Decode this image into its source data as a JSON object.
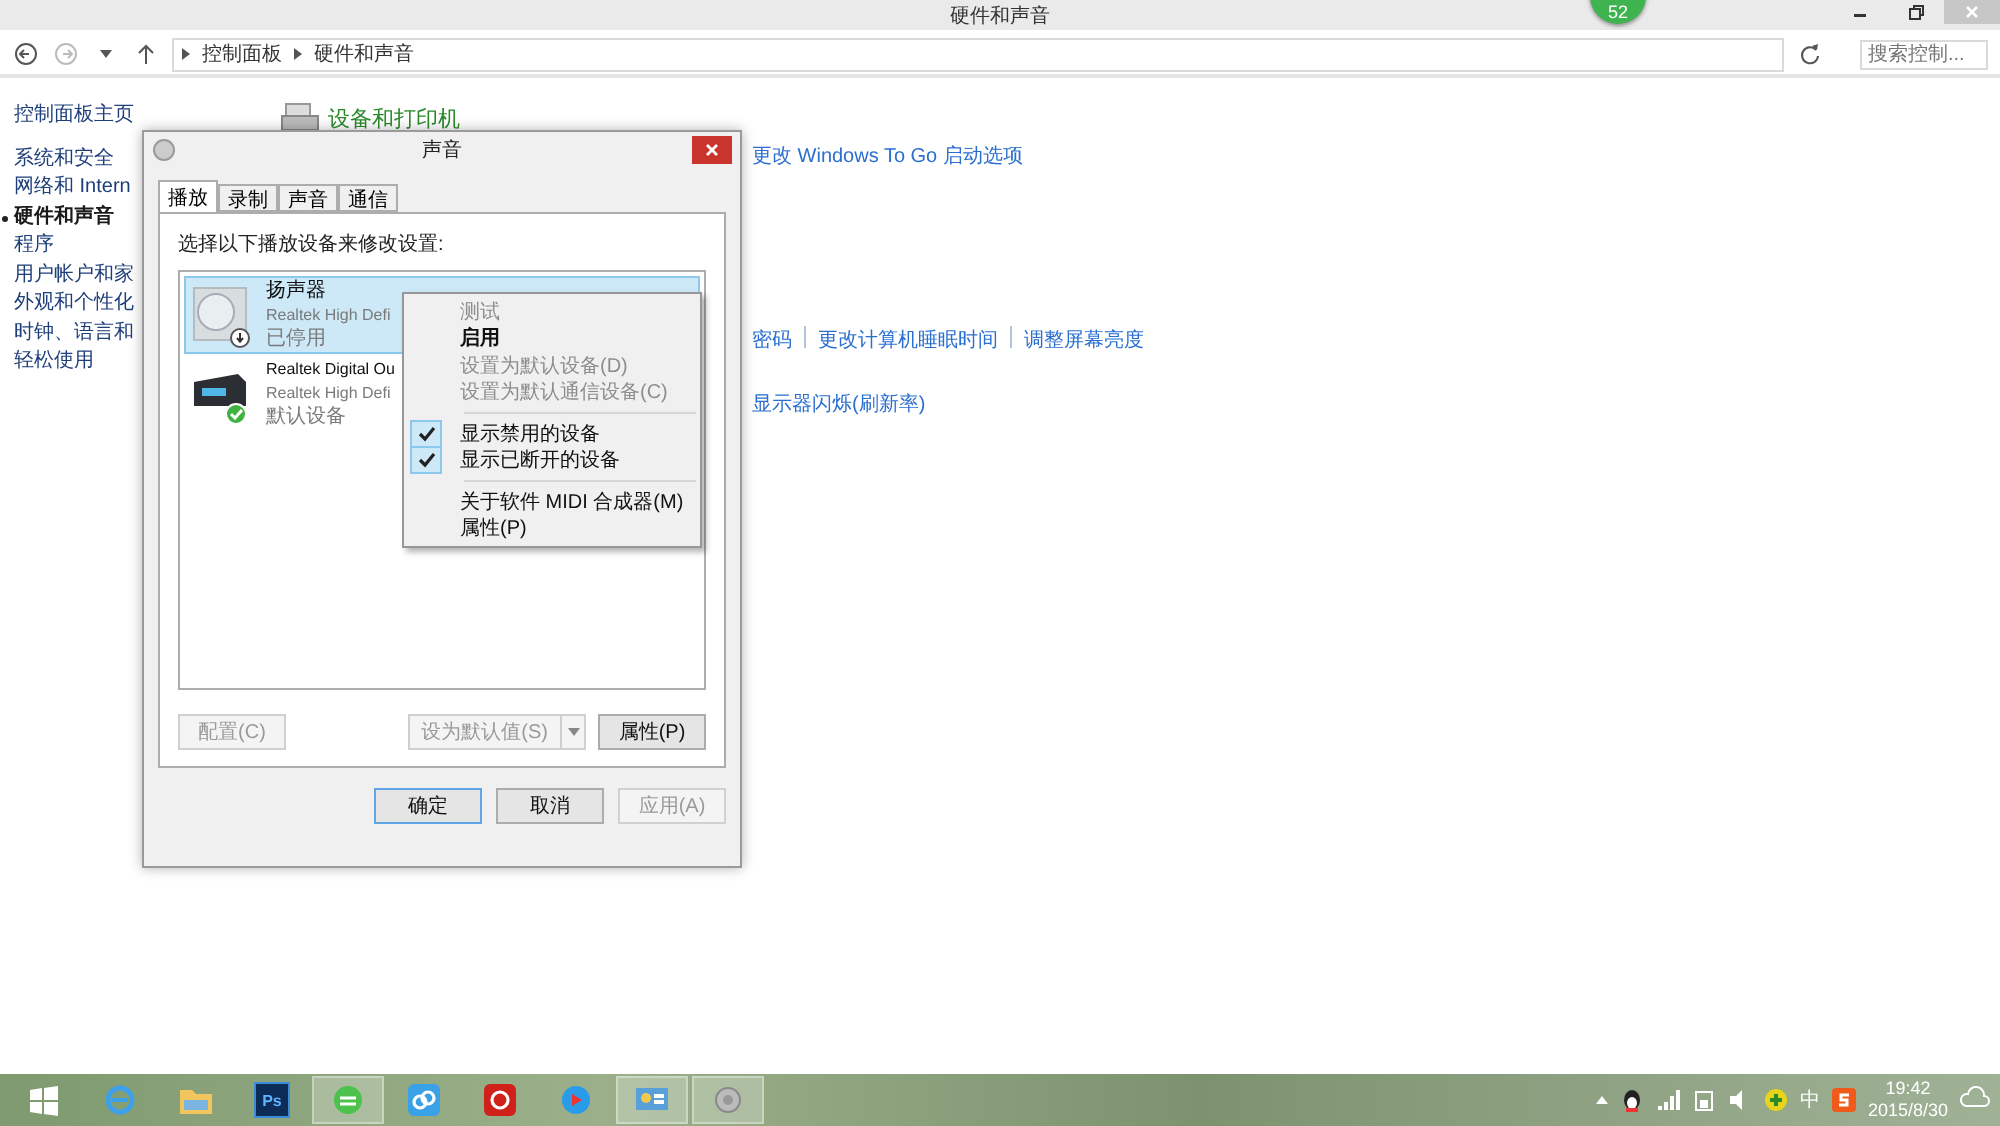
{
  "window": {
    "title": "硬件和声音"
  },
  "address_bar": {
    "crumbs": [
      "控制面板",
      "硬件和声音"
    ]
  },
  "search": {
    "placeholder": "搜索控制..."
  },
  "floating_badge": "52",
  "sidebar": {
    "items": [
      {
        "label": "控制面板主页",
        "selected": false
      },
      {
        "label": "系统和安全",
        "selected": false
      },
      {
        "label": "网络和 Intern",
        "selected": false
      },
      {
        "label": "硬件和声音",
        "selected": true
      },
      {
        "label": "程序",
        "selected": false
      },
      {
        "label": "用户帐户和家",
        "selected": false
      },
      {
        "label": "外观和个性化",
        "selected": false
      },
      {
        "label": "时钟、语言和",
        "selected": false
      },
      {
        "label": "轻松使用",
        "selected": false
      }
    ]
  },
  "content": {
    "heading": "设备和打印机",
    "link_rows": [
      [
        "更改 Windows To Go 启动选项"
      ],
      [
        "密码",
        "更改计算机睡眠时间",
        "调整屏幕亮度"
      ],
      [
        "显示器闪烁(刷新率)"
      ]
    ]
  },
  "dialog": {
    "title": "声音",
    "tabs": [
      {
        "label": "播放",
        "selected": true
      },
      {
        "label": "录制",
        "selected": false
      },
      {
        "label": "声音",
        "selected": false
      },
      {
        "label": "通信",
        "selected": false
      }
    ],
    "instruction": "选择以下播放设备来修改设置:",
    "devices": [
      {
        "name": "扬声器",
        "driver": "Realtek High Defi",
        "status": "已停用",
        "kind": "speaker",
        "selected": true
      },
      {
        "name": "Realtek Digital Ou",
        "driver": "Realtek High Defi",
        "status": "默认设备",
        "kind": "digital",
        "selected": false
      }
    ],
    "buttons": [
      {
        "label": "配置(C)",
        "disabled": true
      },
      {
        "label": "设为默认值(S)",
        "disabled": true
      },
      {
        "label": "属性(P)",
        "disabled": false
      }
    ],
    "footer_buttons": [
      {
        "label": "确定",
        "disabled": false,
        "selected": true
      },
      {
        "label": "取消",
        "disabled": false,
        "selected": false
      },
      {
        "label": "应用(A)",
        "disabled": true,
        "selected": false
      }
    ]
  },
  "context_menu": {
    "groups": [
      [
        {
          "label": "测试",
          "disabled": true,
          "checked": false,
          "bold": false
        },
        {
          "label": "启用",
          "disabled": false,
          "checked": false,
          "bold": true
        },
        {
          "label": "设置为默认设备(D)",
          "disabled": true,
          "checked": false,
          "bold": false
        },
        {
          "label": "设置为默认通信设备(C)",
          "disabled": true,
          "checked": false,
          "bold": false
        }
      ],
      [
        {
          "label": "显示禁用的设备",
          "disabled": false,
          "checked": true,
          "bold": false
        },
        {
          "label": "显示已断开的设备",
          "disabled": false,
          "checked": true,
          "bold": false
        }
      ],
      [
        {
          "label": "关于软件 MIDI 合成器(M)",
          "disabled": false,
          "checked": false,
          "bold": false
        },
        {
          "label": "属性(P)",
          "disabled": false,
          "checked": false,
          "bold": false
        }
      ]
    ]
  },
  "taskbar": {
    "apps": [
      {
        "kind": "start",
        "selected": false
      },
      {
        "kind": "browser",
        "selected": false
      },
      {
        "kind": "folder",
        "selected": false
      },
      {
        "kind": "ps",
        "label": "Ps",
        "selected": false
      },
      {
        "kind": "green",
        "selected": true
      },
      {
        "kind": "cloud",
        "selected": false
      },
      {
        "kind": "music",
        "selected": false
      },
      {
        "kind": "video",
        "selected": false
      },
      {
        "kind": "panel",
        "selected": true
      },
      {
        "kind": "speaker",
        "selected": true
      }
    ],
    "tray": {
      "ime": "中",
      "time": "19:42",
      "date": "2015/8/30"
    }
  }
}
